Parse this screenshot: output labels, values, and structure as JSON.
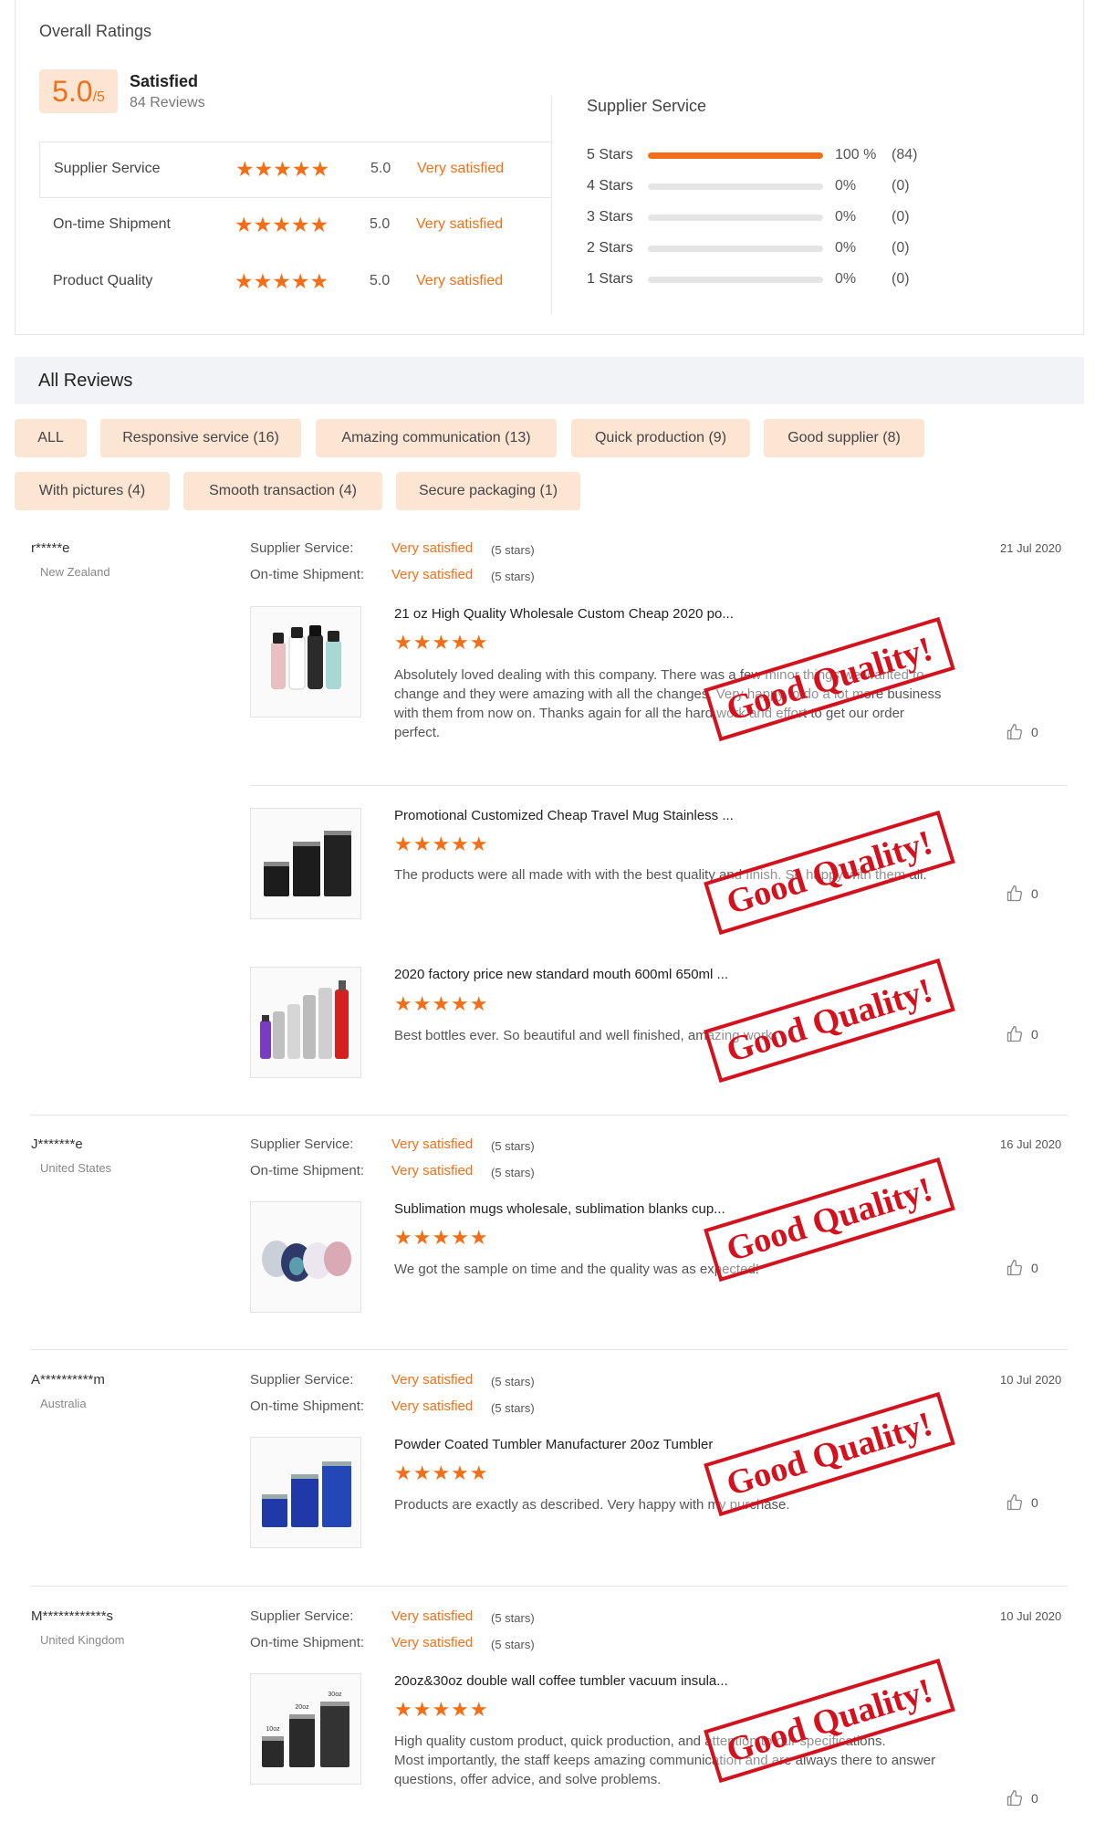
{
  "overall": {
    "heading": "Overall Ratings",
    "score": "5.0",
    "score_suffix": "/5",
    "satisfaction": "Satisfied",
    "review_count": "84 Reviews",
    "categories": [
      {
        "name": "Supplier Service",
        "stars": "★★★★★",
        "value": "5.0",
        "word": "Very satisfied"
      },
      {
        "name": "On-time Shipment",
        "stars": "★★★★★",
        "value": "5.0",
        "word": "Very satisfied"
      },
      {
        "name": "Product Quality",
        "stars": "★★★★★",
        "value": "5.0",
        "word": "Very satisfied"
      }
    ]
  },
  "distribution": {
    "title": "Supplier Service",
    "rows": [
      {
        "label": "5  Stars",
        "fraction": 1.0,
        "pct": "100 %",
        "count": "(84)"
      },
      {
        "label": "4  Stars",
        "fraction": 0,
        "pct": "0%",
        "count": "(0)"
      },
      {
        "label": "3  Stars",
        "fraction": 0,
        "pct": "0%",
        "count": "(0)"
      },
      {
        "label": "2  Stars",
        "fraction": 0,
        "pct": "0%",
        "count": "(0)"
      },
      {
        "label": "1  Stars",
        "fraction": 0,
        "pct": "0%",
        "count": "(0)"
      }
    ]
  },
  "all_reviews": {
    "title": "All Reviews",
    "tags": [
      "ALL",
      "Responsive service (16)",
      "Amazing communication (13)",
      "Quick production (9)",
      "Good supplier (8)",
      "With pictures (4)",
      "Smooth transaction (4)",
      "Secure packaging (1)"
    ]
  },
  "review_labels": {
    "service": "Supplier Service:",
    "shipment": "On-time Shipment:",
    "value": "Very satisfied",
    "stars": "(5 stars)",
    "product_stars": "★★★★★",
    "stamp": "Good Quality!"
  },
  "reviews": [
    {
      "name": "r*****e",
      "country": "New Zealand",
      "date": "21 Jul 2020",
      "products": [
        {
          "title": "21 oz High Quality Wholesale Custom Cheap 2020 po...",
          "text": "Absolutely loved dealing with this company. There was a few minor things we wanted to change and they were amazing with all the changes. Very happy to do a lot more business with them from now on. Thanks again for all the hard work and effort to get our order perfect.",
          "likes": "0",
          "icon": "water-bottles-image"
        },
        {
          "title": "Promotional Customized Cheap Travel Mug Stainless ...",
          "text": "The products were all made with with the best quality and finish. So happy with them all.",
          "likes": "0",
          "icon": "tumblers-image"
        },
        {
          "title": "2020 factory price new standard mouth 600ml 650ml ...",
          "text": "Best bottles ever. So beautiful and well finished, amazing work",
          "likes": "0",
          "icon": "steel-bottles-image"
        }
      ]
    },
    {
      "name": "J*******e",
      "country": "United States",
      "date": "16 Jul 2020",
      "products": [
        {
          "title": "Sublimation mugs wholesale, sublimation blanks cup...",
          "text": "We got the sample on time and the quality was as expected!",
          "likes": "0",
          "icon": "wine-tumblers-image"
        }
      ]
    },
    {
      "name": "A**********m",
      "country": "Australia",
      "date": "10 Jul 2020",
      "products": [
        {
          "title": "Powder Coated Tumbler Manufacturer 20oz Tumbler",
          "text": "Products are exactly as described. Very happy with my purchase.",
          "likes": "0",
          "icon": "blue-tumblers-image"
        }
      ]
    },
    {
      "name": "M************s",
      "country": "United Kingdom",
      "date": "10 Jul 2020",
      "products": [
        {
          "title": "20oz&30oz double wall coffee tumbler vacuum insula...",
          "text": "High quality custom product, quick production, and attention to our specifications.\nMost importantly, the staff keeps amazing communication and are always there to answer questions, offer advice, and solve problems.",
          "likes": "0",
          "icon": "coffee-tumblers-image",
          "size_labels": [
            "10oz",
            "20oz",
            "30oz"
          ]
        }
      ]
    }
  ],
  "colors": {
    "accent": "#f36f17",
    "badge_bg": "#fde5d4",
    "stamp": "#d4121e",
    "header_bg": "#f2f3f7"
  }
}
